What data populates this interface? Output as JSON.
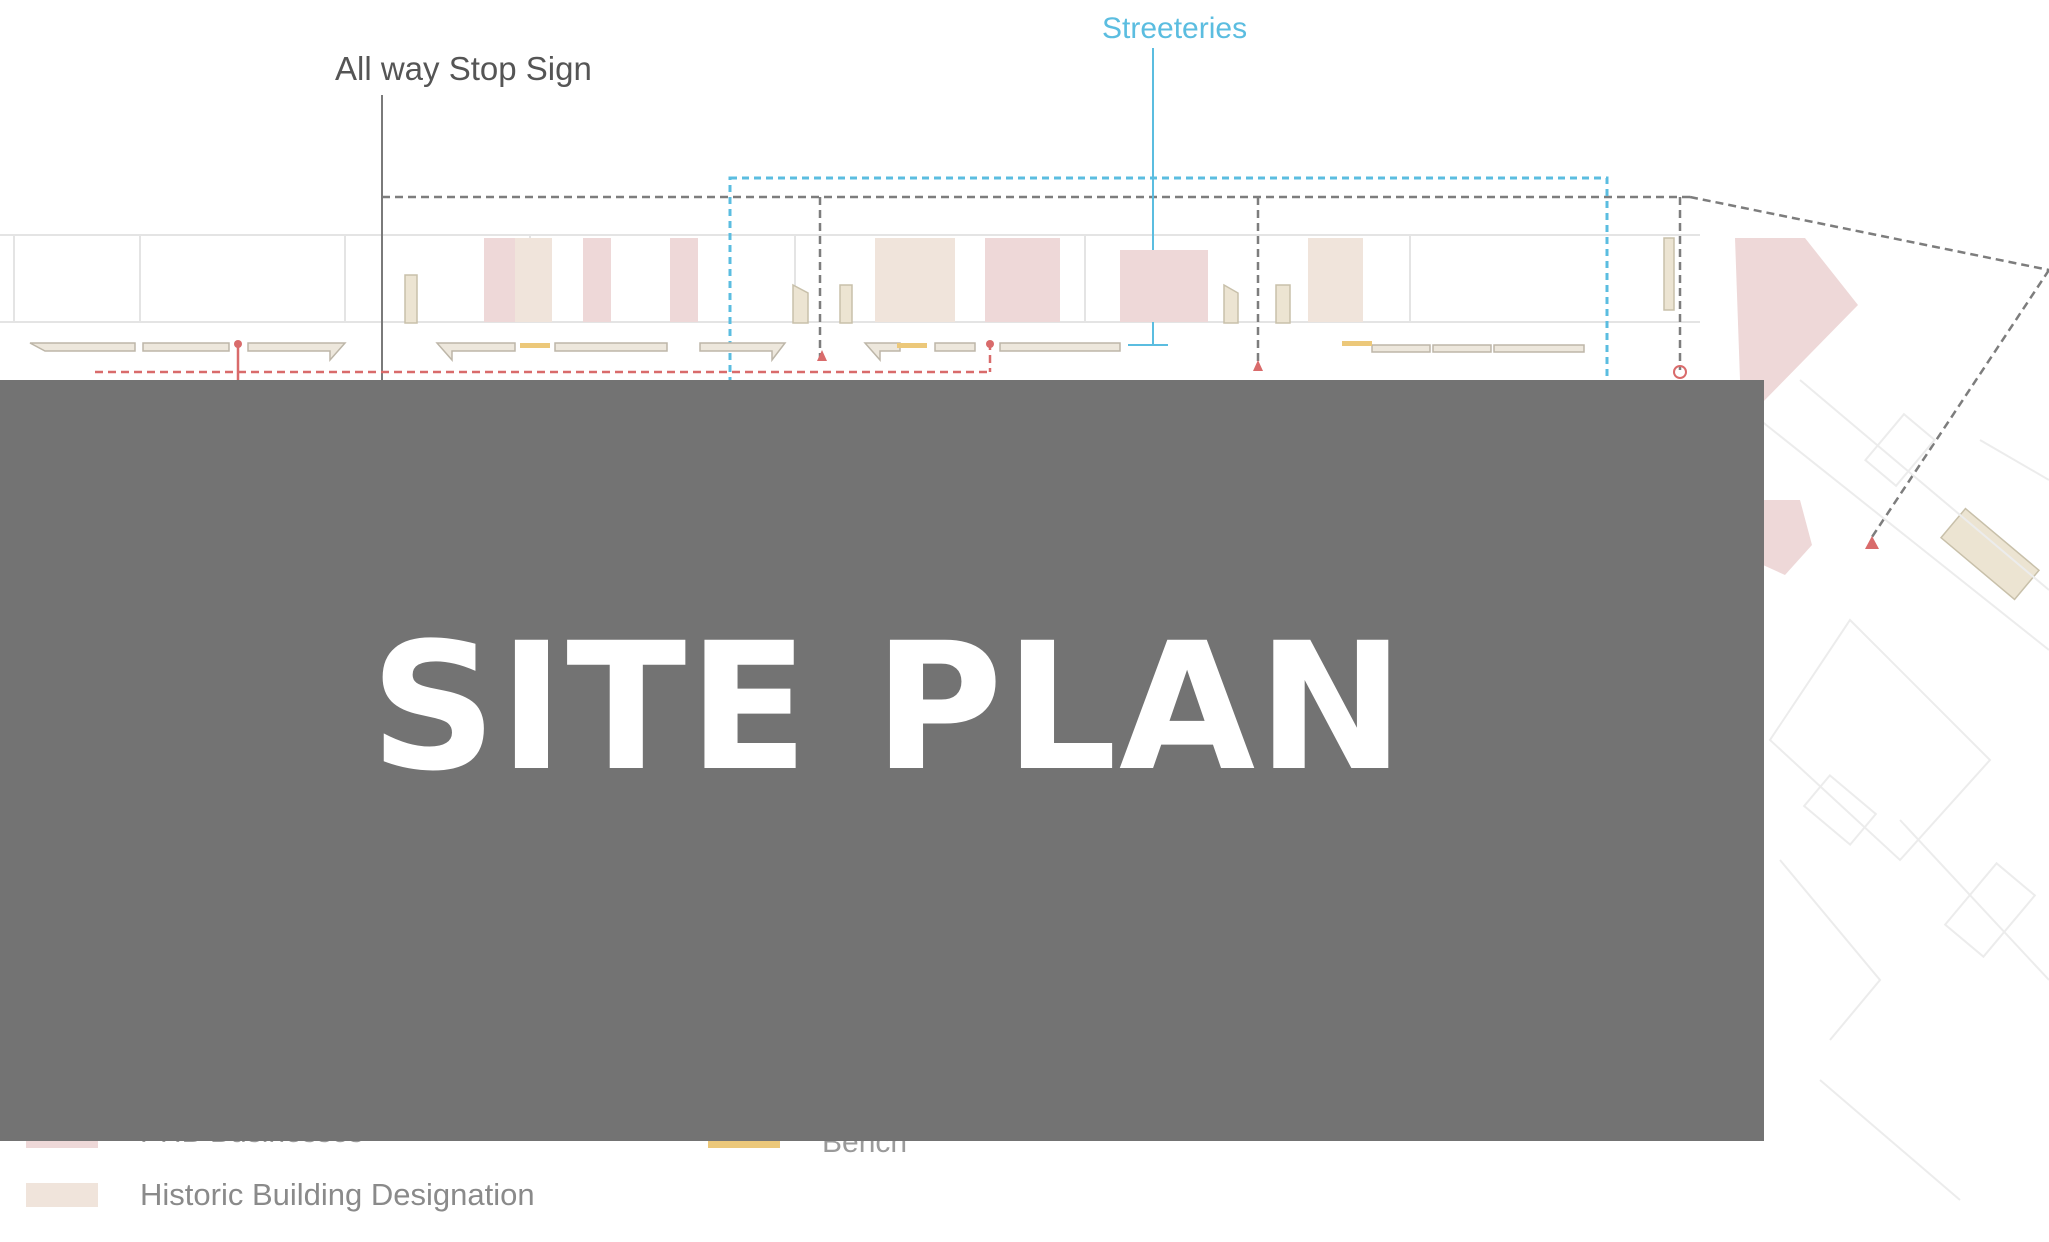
{
  "callouts": {
    "stop_sign": "All way Stop Sign",
    "streeteries": "Streeteries"
  },
  "title": "SITE PLAN",
  "legend": {
    "partial_top_left": "PHB Businesses",
    "partial_top_right": "Bench",
    "historic": "Historic Building Designation"
  },
  "colors": {
    "overlay": "#737373",
    "streeteries_blue": "#5bbde0",
    "route_red": "#d96b6b",
    "pink_fill": "#eed8d8",
    "historic_fill": "#f0e4db",
    "bench_yellow": "#ecc87a",
    "line_gray": "#8a8a8a"
  }
}
